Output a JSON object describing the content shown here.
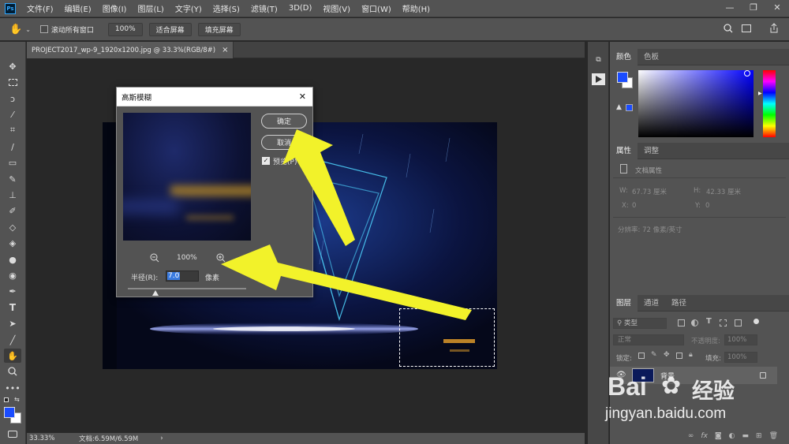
{
  "menubar": {
    "items": [
      "文件(F)",
      "编辑(E)",
      "图像(I)",
      "图层(L)",
      "文字(Y)",
      "选择(S)",
      "滤镜(T)",
      "3D(D)",
      "视图(V)",
      "窗口(W)",
      "帮助(H)"
    ],
    "logo": "Ps",
    "minimize": "—",
    "restore": "❐",
    "close": "✕"
  },
  "options": {
    "scroll_all_windows": "滚动所有窗口",
    "zoom_100": "100%",
    "fit_screen": "适合屏幕",
    "fill_screen": "填充屏幕"
  },
  "document": {
    "tab_title": "PROJECT2017_wp-9_1920x1200.jpg @ 33.3%(RGB/8#)",
    "tab_close": "×"
  },
  "status": {
    "zoom": "33.33%",
    "doc_info": "文档:6.59M/6.59M",
    "chevron": "›"
  },
  "dialog": {
    "title": "高斯模糊",
    "close": "✕",
    "ok": "确定",
    "cancel": "取消",
    "preview_label": "预览(P)",
    "preview_checked": true,
    "zoom_percent": "100%",
    "radius_label": "半径(R):",
    "radius_value": "7.0",
    "radius_unit": "像素",
    "radius_slider_fraction": 0.1
  },
  "color_panel": {
    "tab_color": "颜色",
    "tab_swatches": "色板",
    "foreground": "#1a4cff",
    "background": "#ffffff",
    "hue": "#0000ff"
  },
  "properties_panel": {
    "tab_properties": "属性",
    "tab_adjustments": "调整",
    "doc_props": "文档属性",
    "w_label": "W:",
    "w_value": "67.73 厘米",
    "h_label": "H:",
    "h_value": "42.33 厘米",
    "x_label": "X:",
    "x_value": "0",
    "y_label": "Y:",
    "y_value": "0",
    "resolution": "分辨率: 72 像素/英寸"
  },
  "layers_panel": {
    "tab_layers": "图层",
    "tab_channels": "通道",
    "tab_paths": "路径",
    "filter_kind": "类型",
    "blend_mode": "正常",
    "opacity_label": "不透明度:",
    "opacity_value": "100%",
    "lock_label": "锁定:",
    "fill_label": "填充:",
    "fill_value": "100%",
    "layer_name": "背景"
  },
  "watermark": {
    "brand": "Bai",
    "brand2": "经验",
    "url": "jingyan.baidu.com"
  },
  "colors": {
    "arrow": "#f2f22a",
    "ui_bg": "#535353"
  }
}
